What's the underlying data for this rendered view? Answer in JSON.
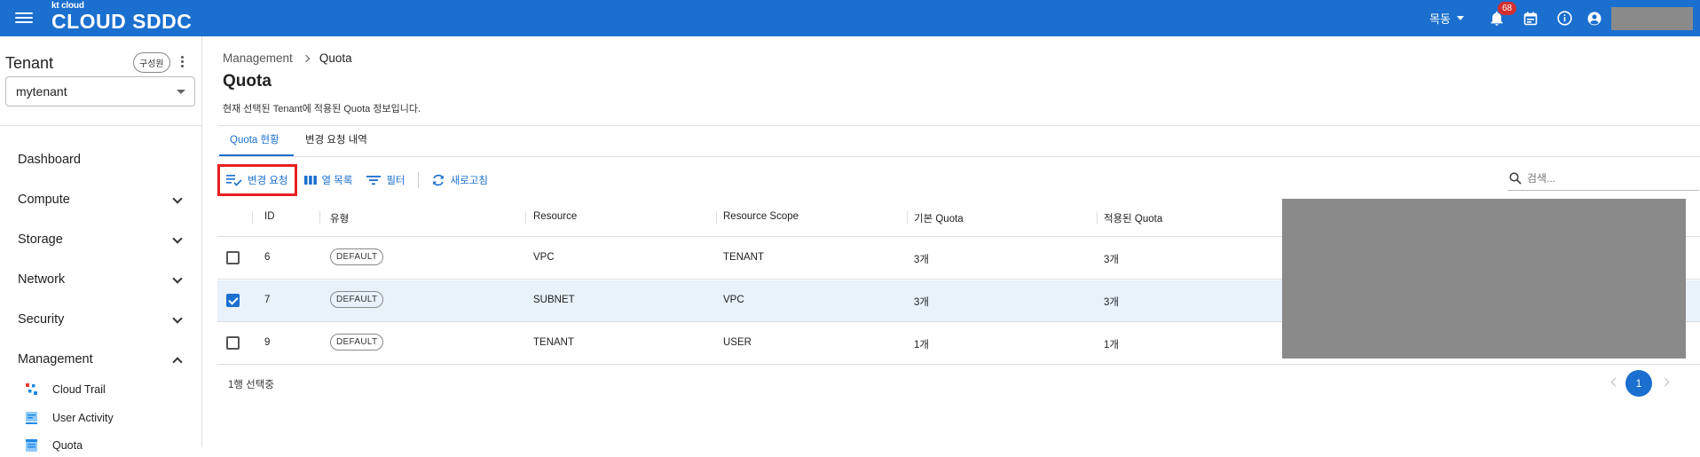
{
  "app": {
    "logo_sub": "kt cloud",
    "logo_main": "CLOUD SDDC",
    "user_name": "목동",
    "notification_count": "68",
    "icons": [
      "menu-icon",
      "bell-icon",
      "calendar-icon",
      "info-icon",
      "account-icon"
    ]
  },
  "sidebar": {
    "title": "Tenant",
    "member_chip": "구성원",
    "tenant_value": "mytenant",
    "items": [
      {
        "label": "Dashboard"
      },
      {
        "label": "Compute"
      },
      {
        "label": "Storage"
      },
      {
        "label": "Network"
      },
      {
        "label": "Security"
      },
      {
        "label": "Management"
      }
    ],
    "sub_items": [
      {
        "label": "Cloud Trail"
      },
      {
        "label": "User Activity"
      },
      {
        "label": "Quota"
      }
    ]
  },
  "main": {
    "breadcrumb": [
      "Management",
      "Quota"
    ],
    "title": "Quota",
    "description": "현재 선택된 Tenant에 적용된 Quota 정보입니다.",
    "tabs": [
      {
        "label": "Quota 현황",
        "active": true
      },
      {
        "label": "변경 요청 내역",
        "active": false
      }
    ],
    "toolbar": {
      "change_request": "변경 요청",
      "columns": "열 목록",
      "filter": "필터",
      "refresh": "새로고침"
    },
    "search_placeholder": "검색...",
    "table": {
      "headers": [
        "ID",
        "유형",
        "Resource",
        "Resource Scope",
        "기본 Quota",
        "적용된 Quota"
      ],
      "rows": [
        {
          "checked": false,
          "id": "6",
          "type": "DEFAULT",
          "resource": "VPC",
          "scope": "TENANT",
          "base": "3개",
          "applied": "3개"
        },
        {
          "checked": true,
          "id": "7",
          "type": "DEFAULT",
          "resource": "SUBNET",
          "scope": "VPC",
          "base": "3개",
          "applied": "3개"
        },
        {
          "checked": false,
          "id": "9",
          "type": "DEFAULT",
          "resource": "TENANT",
          "scope": "USER",
          "base": "1개",
          "applied": "1개"
        }
      ]
    },
    "selection_text": "1행 선택중",
    "page": "1"
  },
  "colors": {
    "primary": "#1a6fcf",
    "highlight": "#e82020",
    "badge": "#d32f2f",
    "redacted": "#8a8a8a"
  }
}
